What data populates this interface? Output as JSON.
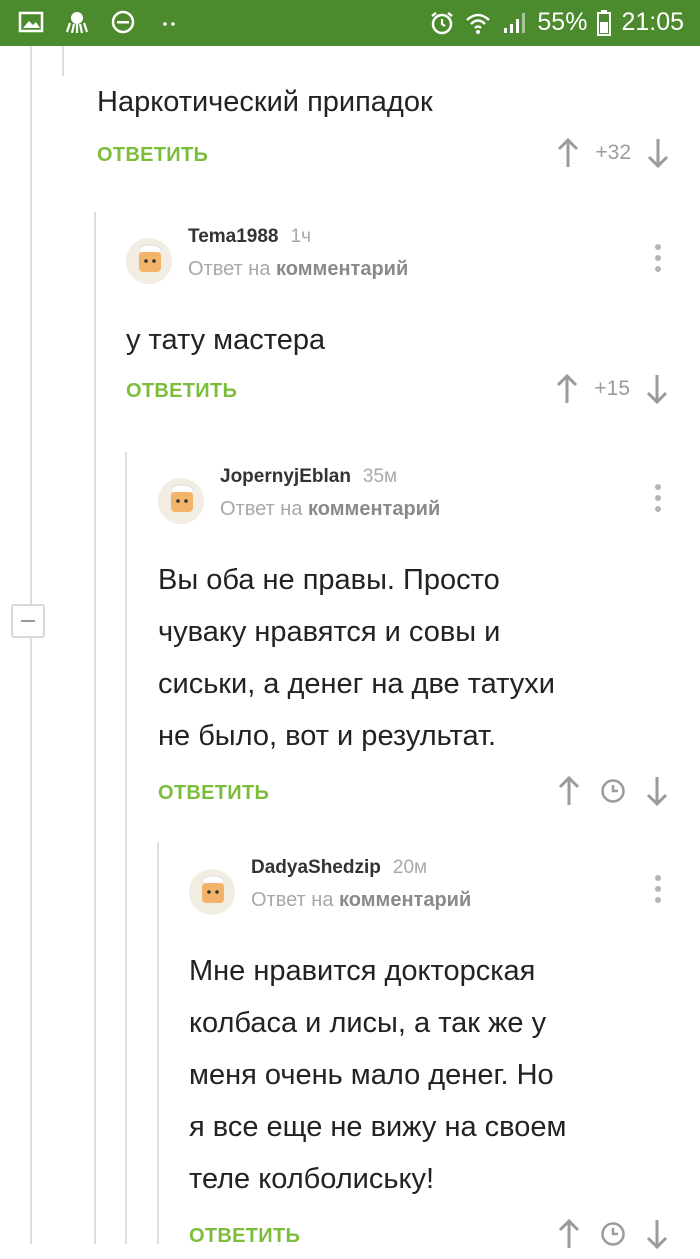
{
  "status_bar": {
    "battery": "55%",
    "time": "21:05",
    "notif_icons": [
      "image-icon",
      "octopus-icon",
      "minus-circle-icon",
      "dots-icon"
    ],
    "sys_icons": [
      "alarm-icon",
      "wifi-icon",
      "signal-icon",
      "battery-icon"
    ]
  },
  "colors": {
    "status_bar": "#4b8a2d",
    "reply": "#7cbd3c",
    "muted": "#a8a8a8"
  },
  "comments": [
    {
      "text": "Наркотический припадок",
      "reply_label": "ОТВЕТИТЬ",
      "score": "+32"
    },
    {
      "author": "Tema1988",
      "time": "1ч",
      "reply_prefix": "Ответ на",
      "reply_target": "комментарий",
      "text": "у тату мастера",
      "reply_label": "ОТВЕТИТЬ",
      "score": "+15"
    },
    {
      "author": "JopernyjEblan",
      "time": "35м",
      "reply_prefix": "Ответ на",
      "reply_target": "комментарий",
      "lines": [
        "Вы оба не правы. Просто",
        "чуваку нравятся и совы и",
        "сиськи, а денег на две татухи",
        "не было, вот и результат."
      ],
      "reply_label": "ОТВЕТИТЬ",
      "score_icon": "clock-icon"
    },
    {
      "author": "DadyaShedzip",
      "time": "20м",
      "reply_prefix": "Ответ на",
      "reply_target": "комментарий",
      "lines": [
        "Мне нравится докторская",
        "колбаса и лисы, а так же у",
        "меня очень мало денег. Но",
        "я все еще не вижу на своем",
        "теле колболиську!"
      ],
      "reply_label": "ОТВЕТИТЬ",
      "score_icon": "clock-icon"
    }
  ]
}
